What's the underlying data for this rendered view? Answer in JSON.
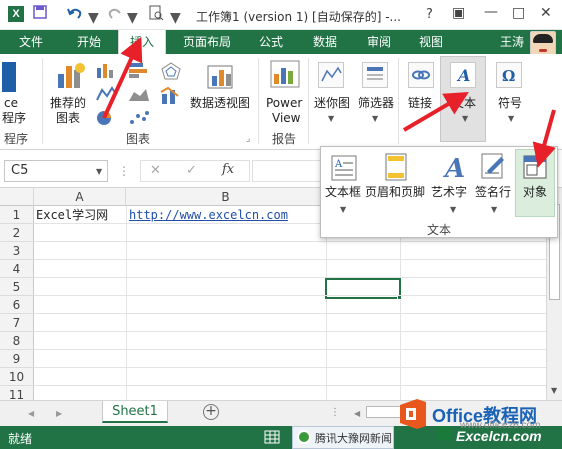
{
  "titlebar": {
    "title": "工作簿1 (version 1) [自动保存的] -...",
    "help": "?",
    "restore": "▣",
    "minimize": "—",
    "maximize": "□",
    "close": "✕"
  },
  "tabs": {
    "file": "文件",
    "home": "开始",
    "insert": "插入",
    "page_layout": "页面布局",
    "formulas": "公式",
    "data": "数据",
    "review": "审阅",
    "view": "视图",
    "user": "王涛"
  },
  "ribbon": {
    "partial_label_1": "ce",
    "partial_label_2": "程序",
    "partial_group": "程序",
    "recommended_charts": [
      "推荐的",
      "图表"
    ],
    "charts_group": "图表",
    "pivot_chart": "数据透视图",
    "power_view": [
      "Power",
      "View"
    ],
    "reports_group": "报告",
    "sparklines": "迷你图",
    "filter": "筛选器",
    "link": "链接",
    "text": "文本",
    "symbol": "符号"
  },
  "text_panel": {
    "textbox": "文本框",
    "header_footer": "页眉和页脚",
    "wordart": "艺术字",
    "signature": "签名行",
    "object": "对象",
    "group": "文本"
  },
  "formula_bar": {
    "namebox": "C5",
    "fx": "fx",
    "cancel": "✕",
    "confirm": "✓"
  },
  "grid": {
    "columns": [
      "A",
      "B"
    ],
    "rows": [
      "1",
      "2",
      "3",
      "4",
      "5",
      "6",
      "7",
      "8",
      "9",
      "10",
      "11"
    ],
    "a1": "Excel学习网",
    "b1": "http://www.excelcn.com"
  },
  "sheet": {
    "tab": "Sheet1",
    "add": "+"
  },
  "status": {
    "ready": "就绪",
    "taskbar_item": "腾讯大豫网新闻"
  },
  "watermark": {
    "brand": "Office教程网",
    "url": "www.office26.com",
    "site": "Excelcn.com"
  },
  "colors": {
    "excel_green": "#217346",
    "arrow_red": "#e8202a",
    "office_orange": "#e8581c"
  }
}
